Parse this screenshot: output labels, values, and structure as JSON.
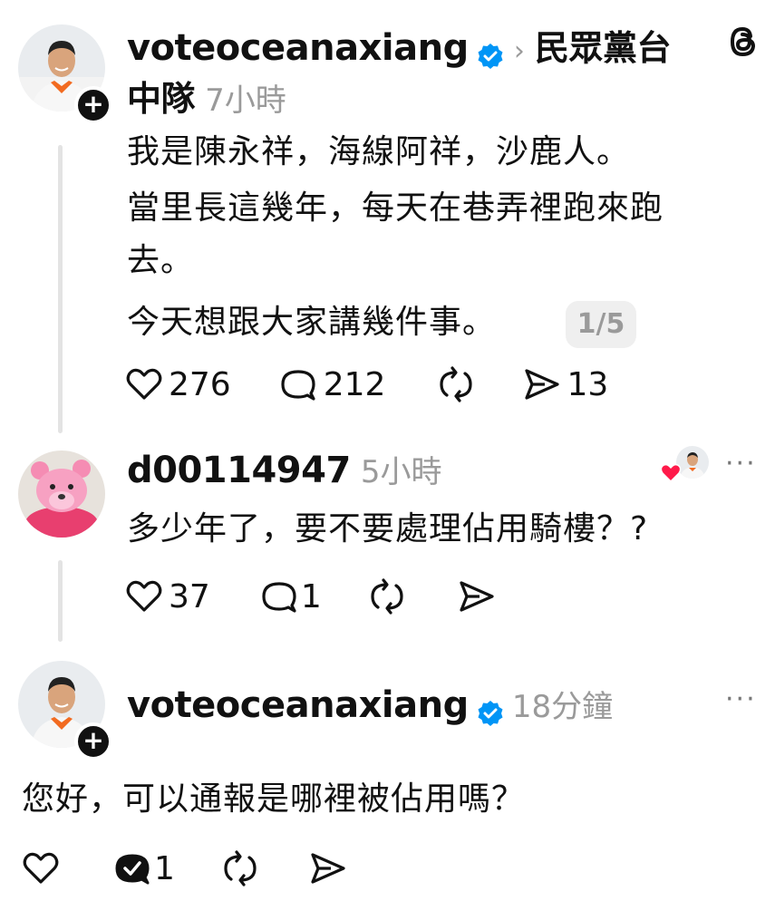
{
  "post": {
    "username": "voteoceanaxiang",
    "community": "民眾黨台",
    "community_cont": "中隊",
    "time": "7小時",
    "lines": [
      "我是陳永祥，海線阿祥，沙鹿人。",
      "當里長這幾年，每天在巷弄裡跑來跑",
      "去。",
      "今天想跟大家講幾件事。"
    ],
    "page_badge": "1/5",
    "likes": "276",
    "replies": "212",
    "shares": "13"
  },
  "reply1": {
    "username": "d00114947",
    "time": "5小時",
    "text": "多少年了，要不要處理佔用騎樓？?",
    "likes": "37",
    "replies": "1",
    "more": "···"
  },
  "reply2": {
    "username": "voteoceanaxiang",
    "time": "18分鐘",
    "text": "您好，可以通報是哪裡被佔用嗎？",
    "replies": "1",
    "more": "···"
  },
  "colors": {
    "verified": "#0095f6",
    "like_heart": "#ff1a4a",
    "muted": "#9a9a9a"
  }
}
